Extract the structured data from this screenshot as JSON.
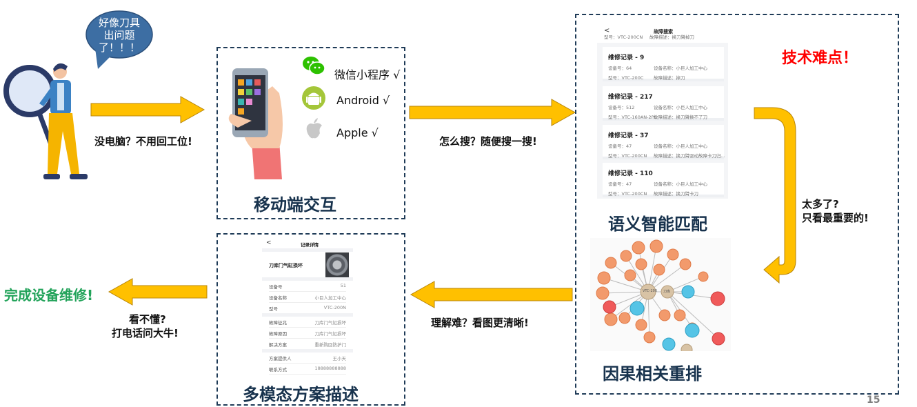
{
  "bubble": {
    "text_line1": "好像刀具",
    "text_line2": "出问题",
    "text_line3": "了！！！"
  },
  "arrow1_label": "没电脑？不用回工位!",
  "mobile_box": {
    "title": "移动端交互",
    "apps": [
      {
        "label": "微信小程序 √",
        "icon": "wechat-icon"
      },
      {
        "label": "Android √",
        "icon": "android-icon"
      },
      {
        "label": "Apple √",
        "icon": "apple-icon"
      }
    ]
  },
  "arrow2_label": "怎么搜？随便搜一搜!",
  "search_screen": {
    "header": "故障搜索",
    "back": "<",
    "top_partial": {
      "model": "型号：VTC-200CN",
      "desc": "故障描述：换刀臂掉刀"
    },
    "records": [
      {
        "title": "维修记录 - 9",
        "device_no": "设备号：64",
        "device_name": "设备名称：小巨人加工中心",
        "model": "型号：VTC-200C",
        "desc": "故障描述：掉刀"
      },
      {
        "title": "维修记录 - 217",
        "device_no": "设备号：512",
        "device_name": "设备名称：小巨人加工中心",
        "model": "型号：VTC-160AN-2PC",
        "desc": "故障描述：换刀臂换不了刀"
      },
      {
        "title": "维修记录 - 37",
        "device_no": "设备号：47",
        "device_name": "设备名称：小巨人加工中心",
        "model": "型号：VTC-200CN",
        "desc": "故障描述：换刀臂驱动故障卡刀归..."
      },
      {
        "title": "维修记录 - 110",
        "device_no": "设备号：47",
        "device_name": "设备名称：小巨人加工中心",
        "model": "型号：VTC-200CN",
        "desc": "故障描述：换刀臂卡刀"
      }
    ]
  },
  "tech_difficulty": "技术难点！",
  "semantic_title": "语义智能匹配",
  "arrow3_label_line1": "太多了?",
  "arrow3_label_line2": "只看最重要的!",
  "causal_title": "因果相关重排",
  "graph_nodes": {
    "center": "VTC-200",
    "center2": "刀库"
  },
  "arrow4_label": "理解难？看图更清晰!",
  "detail_screen": {
    "header": "记录详情",
    "back": "<",
    "fault_title": "刀库门气缸损坏",
    "rows": [
      {
        "k": "设备号",
        "v": "51"
      },
      {
        "k": "设备名称",
        "v": "小巨人加工中心"
      },
      {
        "k": "型号",
        "v": "VTC-200N"
      },
      {
        "k": "故障征兆",
        "v": "刀库门气缸损坏"
      },
      {
        "k": "故障原因",
        "v": "刀库门气缸损坏"
      },
      {
        "k": "解决方案",
        "v": "重新购回防护门"
      },
      {
        "k": "方案提供人",
        "v": "王小天"
      },
      {
        "k": "联系方式",
        "v": "18888888888"
      }
    ]
  },
  "multimodal_title": "多模态方案描述",
  "arrow5_label_line1": "看不懂?",
  "arrow5_label_line2": "打电话问大牛!",
  "done_label": "完成设备维修!",
  "page_number": "15",
  "colors": {
    "arrow": "#ffc000",
    "arrow_stroke": "#b8860b",
    "box_border": "#1f3b57",
    "title": "#17324d",
    "done": "#22a35a",
    "tech": "#ff0000",
    "bubble": "#3d6ea3"
  }
}
